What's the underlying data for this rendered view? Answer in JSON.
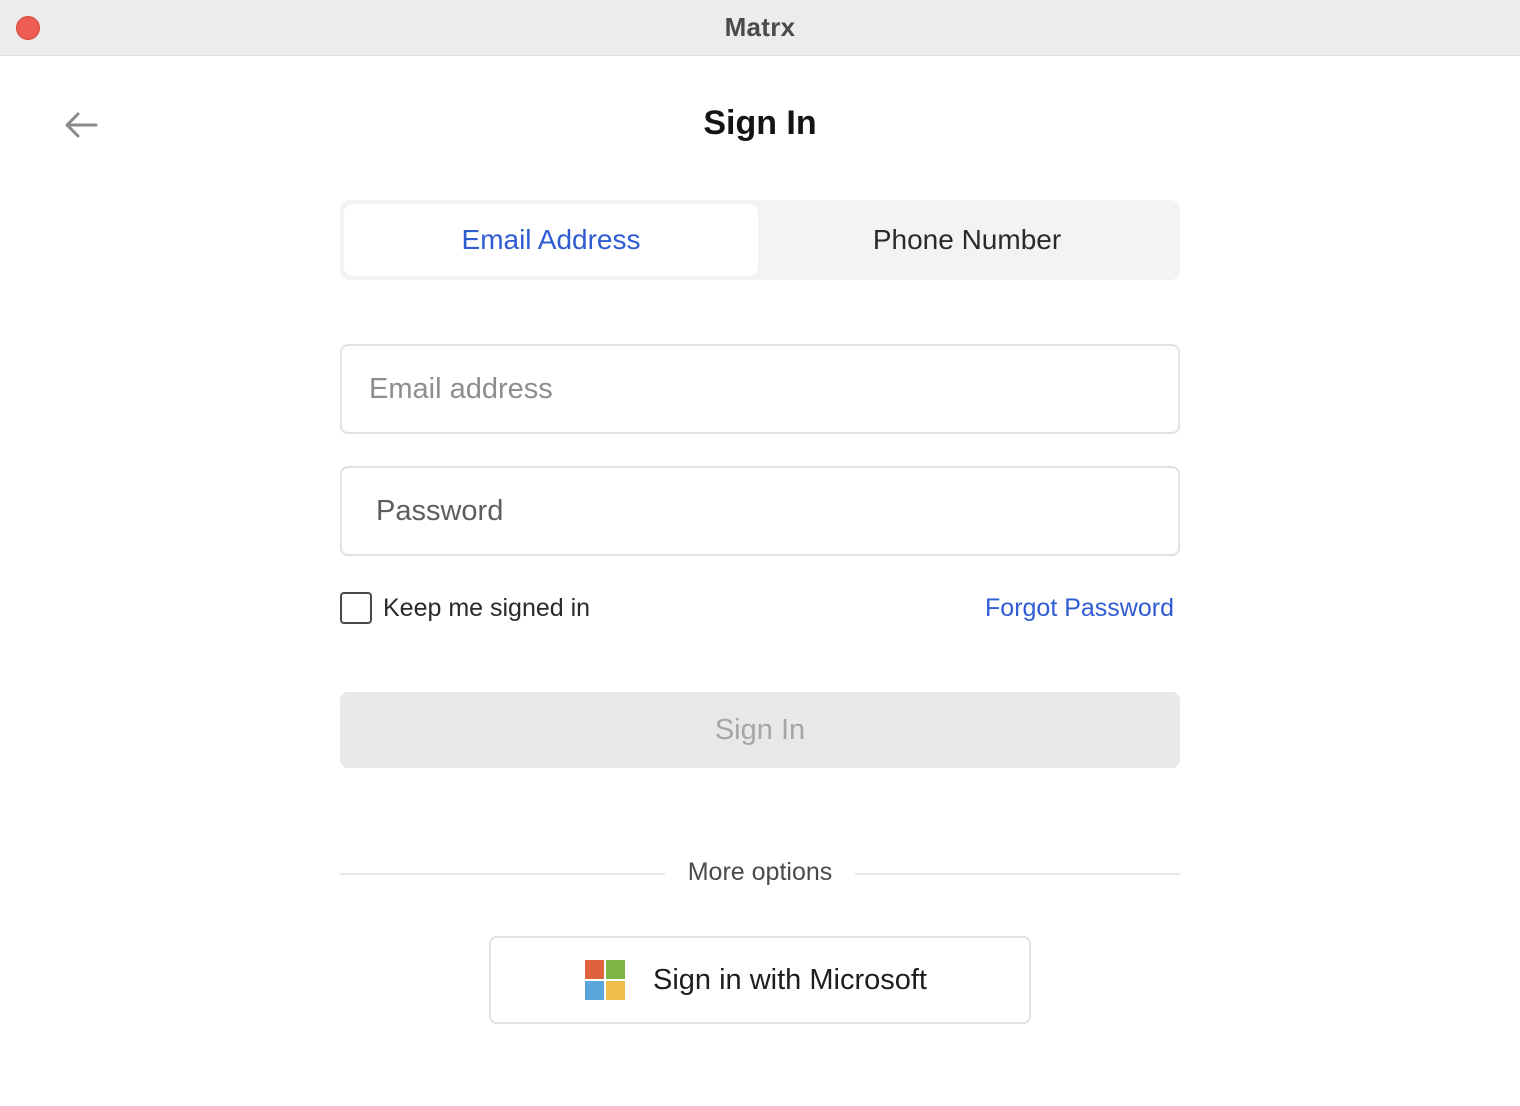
{
  "window": {
    "title": "Matrx"
  },
  "header": {
    "title": "Sign In",
    "back_icon": "arrow-left-icon"
  },
  "tabs": [
    {
      "label": "Email Address",
      "active": true
    },
    {
      "label": "Phone Number",
      "active": false
    }
  ],
  "form": {
    "email_placeholder": "Email address",
    "email_value": "",
    "password_placeholder": "Password",
    "password_value": "",
    "keep_signed_in_label": "Keep me signed in",
    "keep_signed_in_checked": false,
    "forgot_password_label": "Forgot Password",
    "submit_label": "Sign In",
    "submit_enabled": false
  },
  "more_options": {
    "label": "More options",
    "microsoft_label": "Sign in with Microsoft",
    "microsoft_icon": "microsoft-logo-icon"
  },
  "colors": {
    "accent": "#2f5bd3",
    "close_button": "#ee5c53",
    "disabled_button_bg": "#e8e8e8",
    "disabled_button_text": "#a6a6a6"
  }
}
